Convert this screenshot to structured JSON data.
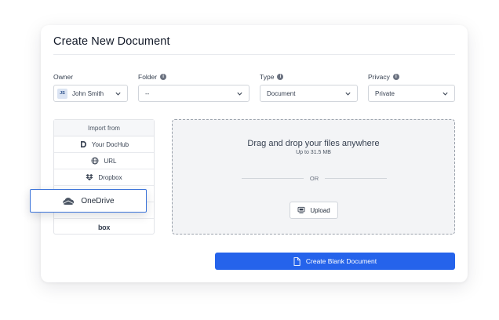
{
  "dialog": {
    "title": "Create New Document"
  },
  "fields": {
    "owner": {
      "label": "Owner",
      "value": "John Smith",
      "avatar_initials": "JS"
    },
    "folder": {
      "label": "Folder",
      "value": "--"
    },
    "type": {
      "label": "Type",
      "value": "Document"
    },
    "privacy": {
      "label": "Privacy",
      "value": "Private"
    }
  },
  "import": {
    "header": "Import from",
    "items": [
      {
        "label": "Your DocHub",
        "icon": "dochub-icon"
      },
      {
        "label": "URL",
        "icon": "globe-icon"
      },
      {
        "label": "Dropbox",
        "icon": "dropbox-icon"
      }
    ],
    "highlighted": {
      "label": "OneDrive",
      "icon": "onedrive-icon"
    },
    "box_logo": "box"
  },
  "dropzone": {
    "title": "Drag and drop your files anywhere",
    "subtitle": "Up to 31.5 MB",
    "or_text": "OR",
    "upload_label": "Upload"
  },
  "actions": {
    "create_blank_label": "Create Blank Document"
  },
  "colors": {
    "accent": "#2563eb",
    "popup_border": "#3b73d9",
    "dropzone_bg": "#f3f4f6"
  }
}
